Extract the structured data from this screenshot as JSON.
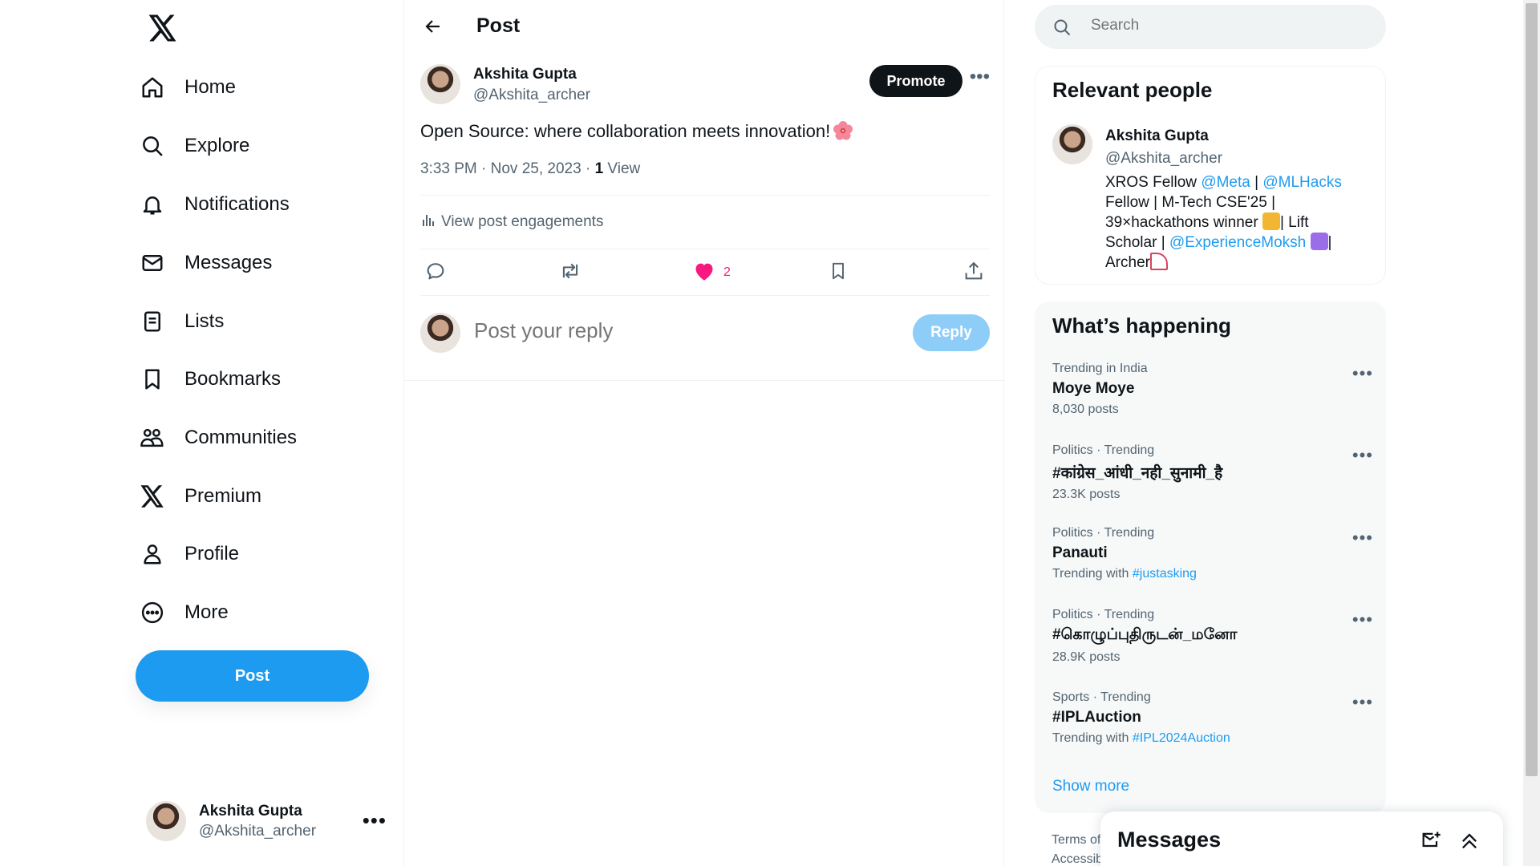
{
  "nav": {
    "items": [
      {
        "label": "Home",
        "icon": "home-icon"
      },
      {
        "label": "Explore",
        "icon": "search-icon"
      },
      {
        "label": "Notifications",
        "icon": "bell-icon"
      },
      {
        "label": "Messages",
        "icon": "envelope-icon"
      },
      {
        "label": "Lists",
        "icon": "list-icon"
      },
      {
        "label": "Bookmarks",
        "icon": "bookmark-icon"
      },
      {
        "label": "Communities",
        "icon": "communities-icon"
      },
      {
        "label": "Premium",
        "icon": "x-logo-icon"
      },
      {
        "label": "Profile",
        "icon": "person-icon"
      },
      {
        "label": "More",
        "icon": "more-circle-icon"
      }
    ],
    "post_button": "Post",
    "account": {
      "name": "Akshita Gupta",
      "handle": "@Akshita_archer"
    }
  },
  "main": {
    "header_title": "Post",
    "tweet": {
      "author_name": "Akshita Gupta",
      "author_handle": "@Akshita_archer",
      "promote_label": "Promote",
      "text": "Open Source: where collaboration meets innovation!",
      "time": "3:33 PM · Nov 25, 2023 · ",
      "views_count": "1",
      "views_label": " View",
      "engagements_label": "View post engagements",
      "like_count": "2"
    },
    "reply": {
      "placeholder": "Post your reply",
      "button": "Reply"
    }
  },
  "right": {
    "search_placeholder": "Search",
    "relevant": {
      "title": "Relevant people",
      "name": "Akshita Gupta",
      "handle": "@Akshita_archer",
      "bio_1": "XROS Fellow ",
      "bio_link_1": "@Meta",
      "bio_2": " | ",
      "bio_link_2": "@MLHacks",
      "bio_3": " Fellow | M-Tech CSE'25 | 39×hackathons winner ",
      "bio_4": "| Lift Scholar | ",
      "bio_link_3": "@ExperienceMoksh",
      "bio_5": "| Archer"
    },
    "happening": {
      "title": "What’s happening",
      "trends": [
        {
          "context": "Trending in India",
          "name": "Moye Moye",
          "sub": "8,030 posts",
          "sub_link": ""
        },
        {
          "context": "Politics · Trending",
          "name": "#कांग्रेस_आंधी_नही_सुनामी_है",
          "sub": "23.3K posts",
          "sub_link": ""
        },
        {
          "context": "Politics · Trending",
          "name": "Panauti",
          "sub": "Trending with ",
          "sub_link": "#justasking"
        },
        {
          "context": "Politics · Trending",
          "name": "#கொழுப்புதிருடன்_மனோ",
          "sub": "28.9K posts",
          "sub_link": ""
        },
        {
          "context": "Sports · Trending",
          "name": "#IPLAuction",
          "sub": "Trending with ",
          "sub_link": "#IPL2024Auction"
        }
      ],
      "show_more": "Show more"
    },
    "footer_1": "Terms of",
    "footer_2": "Accessib"
  },
  "messages_drawer": {
    "title": "Messages"
  },
  "colors": {
    "accent": "#1d9bf0",
    "like": "#f91880",
    "text": "#0f1419",
    "muted": "#536471"
  }
}
